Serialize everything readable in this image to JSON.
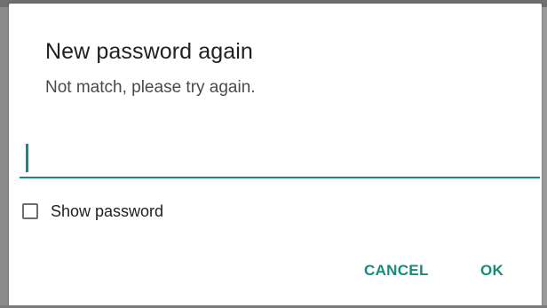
{
  "dialog": {
    "title": "New password again",
    "message": "Not match, please try again.",
    "password_value": "",
    "show_password_label": "Show password",
    "show_password_checked": false,
    "cancel_label": "CANCEL",
    "ok_label": "OK"
  },
  "colors": {
    "accent": "#138c7e",
    "title_text": "#212121",
    "message_text": "#4a4a4a"
  },
  "icons": {
    "checkbox": "checkbox-unchecked-icon"
  }
}
